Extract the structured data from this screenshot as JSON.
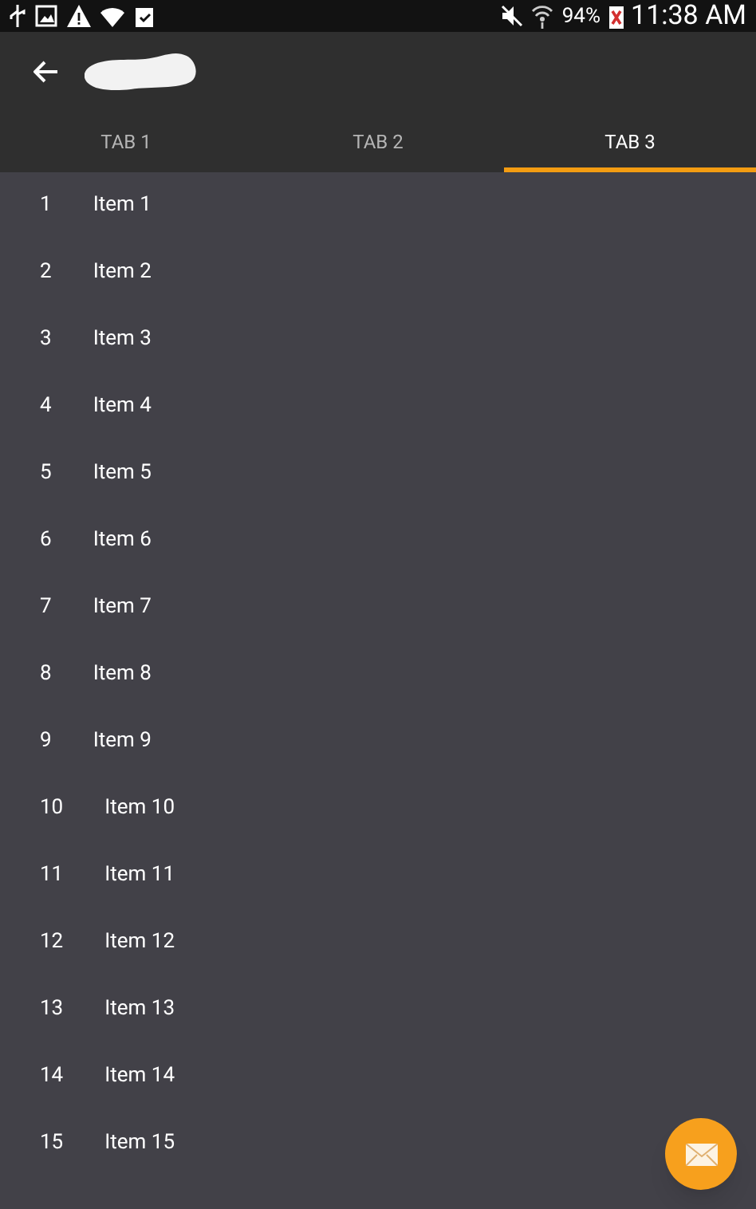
{
  "status_bar": {
    "battery": "94%",
    "time": "11:38 AM"
  },
  "tabs": [
    {
      "label": "TAB 1",
      "selected": false
    },
    {
      "label": "TAB 2",
      "selected": false
    },
    {
      "label": "TAB 3",
      "selected": true
    }
  ],
  "list": [
    {
      "number": "1",
      "label": "Item 1"
    },
    {
      "number": "2",
      "label": "Item 2"
    },
    {
      "number": "3",
      "label": "Item 3"
    },
    {
      "number": "4",
      "label": "Item 4"
    },
    {
      "number": "5",
      "label": "Item 5"
    },
    {
      "number": "6",
      "label": "Item 6"
    },
    {
      "number": "7",
      "label": "Item 7"
    },
    {
      "number": "8",
      "label": "Item 8"
    },
    {
      "number": "9",
      "label": "Item 9"
    },
    {
      "number": "10",
      "label": "Item 10"
    },
    {
      "number": "11",
      "label": "Item 11"
    },
    {
      "number": "12",
      "label": "Item 12"
    },
    {
      "number": "13",
      "label": "Item 13"
    },
    {
      "number": "14",
      "label": "Item 14"
    },
    {
      "number": "15",
      "label": "Item 15"
    }
  ]
}
